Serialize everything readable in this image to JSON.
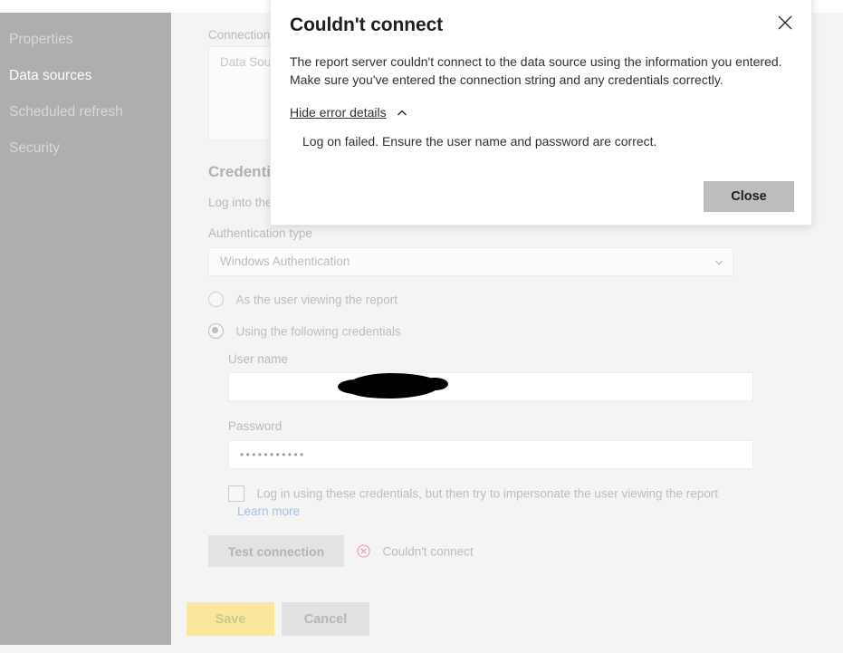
{
  "sidebar": {
    "items": [
      {
        "label": "Properties",
        "selected": false
      },
      {
        "label": "Data sources",
        "selected": true
      },
      {
        "label": "Scheduled refresh",
        "selected": false
      },
      {
        "label": "Security",
        "selected": false
      }
    ]
  },
  "main": {
    "connection_label": "Connection string",
    "connection_placeholder": "Data Source=...",
    "credentials_heading": "Credentials",
    "credentials_sub": "Log into the data source",
    "auth_type_label": "Authentication type",
    "auth_type_value": "Windows Authentication",
    "auth_type_chevron": "chevron-down-icon",
    "radio_user_viewing": "As the user viewing the report",
    "radio_following_credentials": "Using the following credentials",
    "username_label": "User name",
    "username_value": "",
    "password_label": "Password",
    "password_value": "•••••••••••",
    "impersonate_label": "Log in using these credentials, but then try to impersonate the user viewing the report",
    "learn_more_label": "Learn more",
    "test_connection_label": "Test connection",
    "test_status_icon": "error-circle-icon",
    "test_status_text": "Couldn't connect",
    "save_label": "Save",
    "cancel_label": "Cancel"
  },
  "dialog": {
    "title": "Couldn't connect",
    "close_icon": "close-icon",
    "body": "The report server couldn't connect to the data source using the information you entered. Make sure you've entered the connection string and any credentials correctly.",
    "toggle_label": "Hide error details",
    "toggle_chevron": "chevron-up-icon",
    "detail": "Log on failed. Ensure the user name and password are correct.",
    "close_button_label": "Close"
  },
  "colors": {
    "sidebar_bg": "#aeaeae",
    "page_bg": "#f4f4f4",
    "save_button": "#fae79b",
    "cancel_button": "#e2e2e2",
    "dialog_close_button": "#bdbdbd",
    "error_accent": "#e8a0a0",
    "link": "#a9bedd"
  }
}
